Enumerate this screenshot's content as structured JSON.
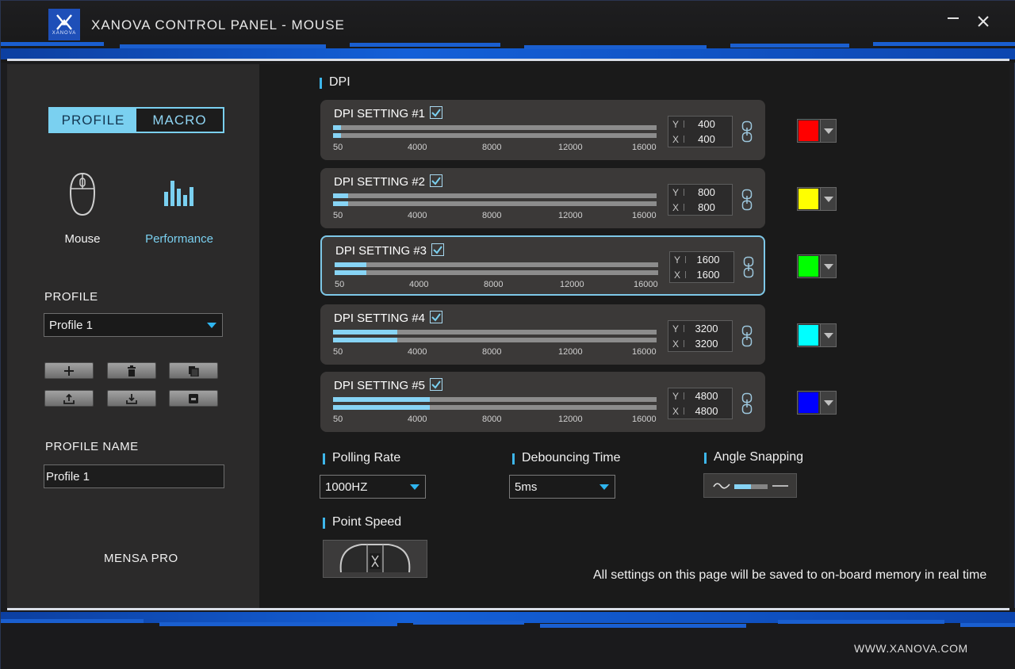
{
  "app": {
    "title": "XANOVA CONTROL PANEL - MOUSE",
    "logo_text": "XANOVA",
    "controls": {
      "minimize": "minimize-icon",
      "close": "close-icon"
    }
  },
  "sidebar": {
    "tabs": [
      {
        "label": "PROFILE",
        "active": true
      },
      {
        "label": "MACRO",
        "active": false
      }
    ],
    "modes": [
      {
        "label": "Mouse",
        "icon": "mouse-icon",
        "active": false
      },
      {
        "label": "Performance",
        "icon": "bar-chart-icon",
        "active": true
      }
    ],
    "profile_label": "PROFILE",
    "profile_selected": "Profile 1",
    "profile_buttons": [
      "add-icon",
      "delete-icon",
      "copy-icon",
      "export-icon",
      "import-icon",
      "save-icon"
    ],
    "profile_name_label": "PROFILE NAME",
    "profile_name_value": "Profile 1",
    "device_name": "MENSA PRO"
  },
  "main": {
    "dpi_header": "DPI",
    "dpi_scale": {
      "min": 50,
      "max": 16000,
      "ticks": [
        "50",
        "4000",
        "8000",
        "12000",
        "16000"
      ]
    },
    "dpi_settings": [
      {
        "label": "DPI SETTING #1",
        "enabled": true,
        "y": "400",
        "x": "400",
        "color": "#ff0000",
        "selected": false
      },
      {
        "label": "DPI SETTING #2",
        "enabled": true,
        "y": "800",
        "x": "800",
        "color": "#ffff00",
        "selected": false
      },
      {
        "label": "DPI SETTING #3",
        "enabled": true,
        "y": "1600",
        "x": "1600",
        "color": "#00ff00",
        "selected": true
      },
      {
        "label": "DPI SETTING #4",
        "enabled": true,
        "y": "3200",
        "x": "3200",
        "color": "#00ffff",
        "selected": false
      },
      {
        "label": "DPI SETTING #5",
        "enabled": true,
        "y": "4800",
        "x": "4800",
        "color": "#0000ff",
        "selected": false
      }
    ],
    "axis_labels": {
      "y": "Y",
      "x": "X"
    },
    "polling_rate": {
      "label": "Polling Rate",
      "value": "1000HZ"
    },
    "debounce": {
      "label": "Debouncing Time",
      "value": "5ms"
    },
    "angle_snapping": {
      "label": "Angle Snapping",
      "state": 0.5
    },
    "point_speed": {
      "label": "Point Speed"
    },
    "note": "All settings on this page will be saved to on-board memory in real time"
  },
  "footer": {
    "url": "WWW.XANOVA.COM"
  },
  "colors": {
    "accent": "#7ad0f0",
    "accent_dark": "#2fb5ef",
    "brand_blue": "#1460d8"
  }
}
